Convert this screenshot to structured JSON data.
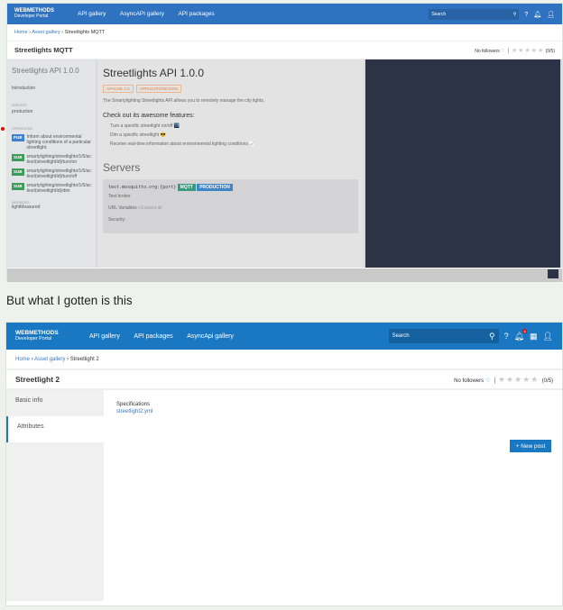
{
  "expected": {
    "brand": {
      "name": "WEBMETHODS",
      "sub": "Developer Portal"
    },
    "nav": [
      "API gallery",
      "AsyncAPI gallery",
      "API packages"
    ],
    "search_placeholder": "Search",
    "breadcrumb": [
      "Home",
      "Asset gallery",
      "Streetlights MQTT"
    ],
    "title": "Streetlights MQTT",
    "followers": "No followers",
    "rating": "(0/5)",
    "sidebar": {
      "title": "Streetlights API 1.0.0",
      "intro": "Introduction",
      "servers_label": "SERVERS",
      "server": "production",
      "operations_label": "OPERATIONS",
      "operations": [
        {
          "badge": "PUB",
          "text": "Inform about environmental lighting conditions of a particular streetlight."
        },
        {
          "badge": "SUB",
          "text": "smartylighting/streetlights/1/0/action/{streetlightId}/turn/on"
        },
        {
          "badge": "SUB",
          "text": "smartylighting/streetlights/1/0/action/{streetlightId}/turn/off"
        },
        {
          "badge": "SUB",
          "text": "smartylighting/streetlights/1/0/action/{streetlightId}/dim"
        }
      ],
      "messages_label": "MESSAGES",
      "message": "lightMeasured"
    },
    "main": {
      "heading": "Streetlights API 1.0.0",
      "tags": [
        "APACHE 2.0",
        "APPLICATION/JSON"
      ],
      "description": "The Smartylighting Streetlights API allows you to remotely manage the city lights.",
      "features_title": "Check out its awesome features:",
      "features": [
        "Turn a specific streetlight on/off 🌃",
        "Dim a specific streetlight 😎",
        "Receive real-time information about environmental lighting conditions 📈"
      ],
      "servers_heading": "Servers",
      "server_url": "test.mosquitto.org:{port}",
      "protocol": "MQTT",
      "env": "PRODUCTION",
      "server_desc": "Test broker",
      "url_vars": "URL Variables",
      "expand_all": "Expand all",
      "security": "Security:"
    }
  },
  "caption": "But what I gotten is this",
  "actual": {
    "brand": {
      "name": "WEBMETHODS",
      "sub": "Developer Portal"
    },
    "nav": [
      "API gallery",
      "API packages",
      "AsyncApi gallery"
    ],
    "search_placeholder": "Search",
    "notification_count": "4",
    "breadcrumb": [
      "Home",
      "Asset gallery",
      "Streetlight 2"
    ],
    "title": "Streetlight 2",
    "followers": "No followers",
    "rating": "(0/5)",
    "tabs": [
      "Basic info",
      "Attributes"
    ],
    "spec_label": "Specifications",
    "spec_file": "streetlight2.yml",
    "new_post": "+ New post"
  }
}
